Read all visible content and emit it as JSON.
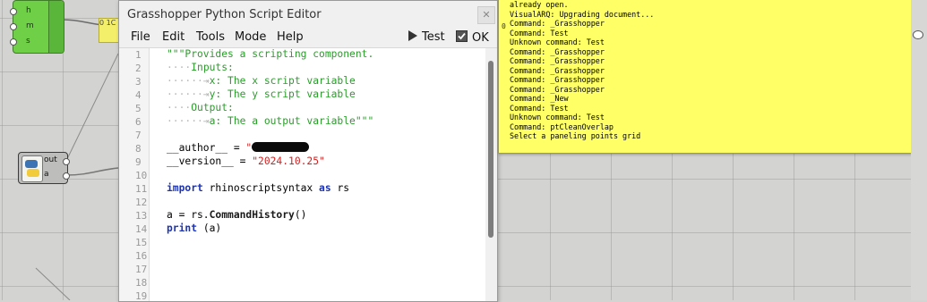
{
  "canvas": {
    "green_component": {
      "inputs": [
        "h",
        "m",
        "s"
      ]
    },
    "small_panel_text": "0 1C",
    "python_component": {
      "outputs": [
        "out",
        "a"
      ]
    }
  },
  "editor": {
    "title": "Grasshopper Python Script Editor",
    "close_label": "✕",
    "menu": [
      "File",
      "Edit",
      "Tools",
      "Mode",
      "Help"
    ],
    "toolbar": {
      "test_label": "Test",
      "ok_label": "OK"
    },
    "line_numbers": [
      "1",
      "2",
      "3",
      "4",
      "5",
      "6",
      "7",
      "8",
      "9",
      "10",
      "11",
      "12",
      "13",
      "14",
      "15",
      "16",
      "17",
      "18",
      "19"
    ],
    "code": {
      "l1": "\"\"\"Provides a scripting component.",
      "l2": "Inputs:",
      "l3": "x: The x script variable",
      "l4": "y: The y script variable",
      "l5": "Output:",
      "l6": "a: The a output variable\"\"\"",
      "author_key": "__author__ = ",
      "author_val": "\"",
      "version_key": "__version__ = ",
      "version_val": "\"2024.10.25\"",
      "import_kw": "import",
      "import_mod": " rhinoscriptsyntax ",
      "as_kw": "as",
      "import_alias": " rs",
      "l13_a": "a = rs.",
      "l13_fn": "CommandHistory",
      "l13_b": "()",
      "print_kw": "print",
      "print_arg": " (a)"
    }
  },
  "command_history": {
    "zero_label": "0",
    "lines": [
      "already open.",
      "VisualARQ: Upgrading document...",
      "Command: _Grasshopper",
      "Command: Test",
      "Unknown command: Test",
      "Command: _Grasshopper",
      "Command: _Grasshopper",
      "Command: _Grasshopper",
      "Command: _Grasshopper",
      "Command: _Grasshopper",
      "Command: _New",
      "Command: Test",
      "Unknown command: Test",
      "Command: ptCleanOverlap",
      "Select a paneling points grid"
    ]
  }
}
